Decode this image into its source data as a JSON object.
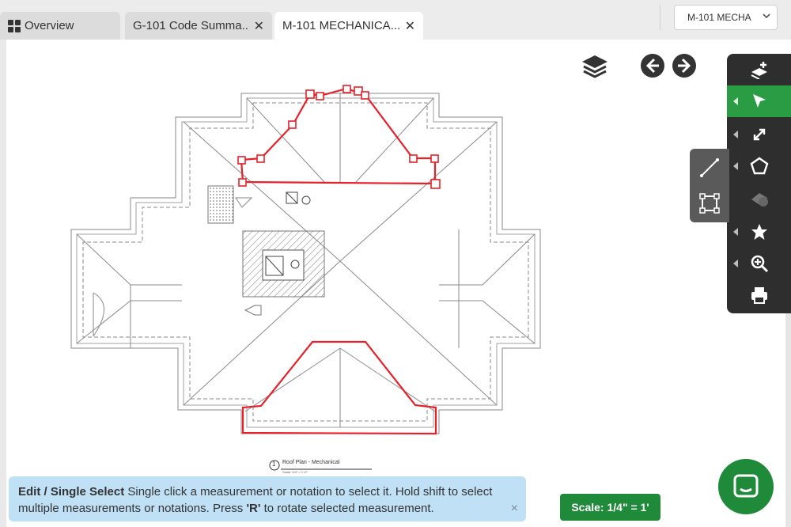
{
  "tabs": [
    {
      "label": "Overview",
      "icon": "dashboard-grid-icon",
      "active": false
    },
    {
      "label": "G-101 Code Summa...",
      "active": false
    },
    {
      "label": "M-101 MECHANICA...",
      "active": true
    }
  ],
  "sheet_select": {
    "value": "M-101 MECHA"
  },
  "drawing": {
    "title_number": "1",
    "title": "Roof Plan - Mechanical",
    "scale_note": "Scale: 1/4\" = 1'-0\""
  },
  "hint": {
    "title": "Edit / Single Select",
    "body_1": " Single click a measurement or notation to select it. Hold shift to select multiple measurements or notations. Press ",
    "key": "'R'",
    "body_2": " to rotate selected measurement.",
    "close": "×"
  },
  "scale_label": "Scale: 1/4\" = 1'",
  "colors": {
    "accent": "#2a9d44",
    "markup": "#e8202a",
    "toolbar": "#2e2e2e",
    "hint_bg": "#bfe0f5"
  },
  "toolbar_tools": [
    "add-layer-icon",
    "select-arrow-icon",
    "expand-icon",
    "polygon-icon",
    "shapes-icon",
    "star-icon",
    "zoom-in-icon",
    "print-icon"
  ],
  "subtools": [
    "line-icon",
    "rectangle-icon"
  ]
}
